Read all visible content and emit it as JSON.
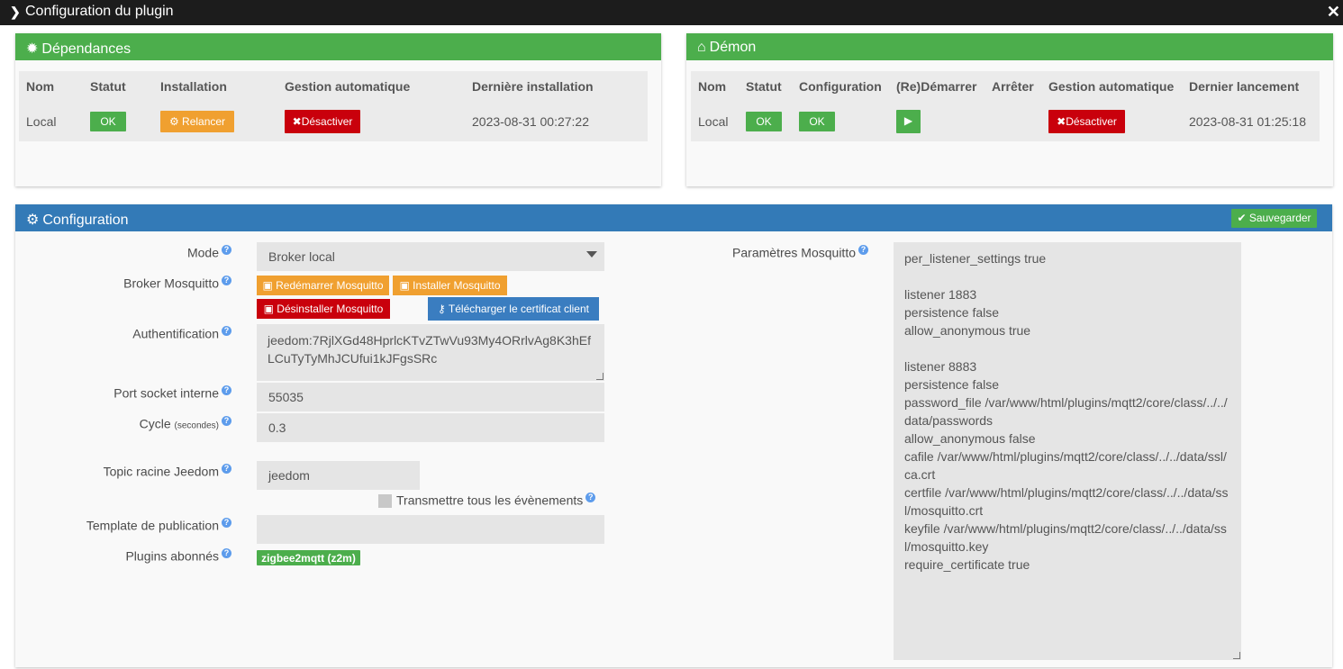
{
  "window": {
    "title": "Configuration du plugin",
    "close_glyph": "✕"
  },
  "dependances": {
    "title": "Dépendances",
    "headers": {
      "nom": "Nom",
      "statut": "Statut",
      "installation": "Installation",
      "gestion": "Gestion automatique",
      "derniere": "Dernière installation"
    },
    "row": {
      "nom": "Local",
      "statut": "OK",
      "installation": "Relancer",
      "gestion": "Désactiver",
      "derniere": "2023-08-31 00:27:22"
    }
  },
  "demon": {
    "title": "Démon",
    "headers": {
      "nom": "Nom",
      "statut": "Statut",
      "configuration": "Configuration",
      "redemarrer": "(Re)Démarrer",
      "arreter": "Arrêter",
      "gestion": "Gestion automatique",
      "dernier": "Dernier lancement"
    },
    "row": {
      "nom": "Local",
      "statut": "OK",
      "configuration": "OK",
      "gestion": "Désactiver",
      "dernier": "2023-08-31 01:25:18"
    }
  },
  "configuration": {
    "title": "Configuration",
    "save_label": "Sauvegarder",
    "mode": {
      "label": "Mode",
      "value": "Broker local"
    },
    "broker": {
      "label": "Broker Mosquitto",
      "restart": "Redémarrer Mosquitto",
      "install": "Installer Mosquitto",
      "uninstall": "Désinstaller Mosquitto",
      "download_cert": "Télécharger le certificat client"
    },
    "auth": {
      "label": "Authentification",
      "value": "jeedom:7RjlXGd48HprlcKTvZTwVu93My4ORrlvAg8K3hEfLCuTyTyMhJCUfui1kJFgsSRc"
    },
    "port": {
      "label": "Port socket interne",
      "value": "55035"
    },
    "cycle": {
      "label": "Cycle",
      "unit": "(secondes)",
      "value": "0.3"
    },
    "topic": {
      "label": "Topic racine Jeedom",
      "value": "jeedom"
    },
    "transmit": {
      "label": "Transmettre tous les évènements",
      "checked": false
    },
    "template": {
      "label": "Template de publication",
      "value": ""
    },
    "plugins": {
      "label": "Plugins abonnés",
      "tag": "zigbee2mqtt (z2m)"
    },
    "mosquitto_params": {
      "label": "Paramètres Mosquitto",
      "value": "per_listener_settings true\n\nlistener 1883\npersistence false\nallow_anonymous true\n\nlistener 8883\npersistence false\npassword_file /var/www/html/plugins/mqtt2/core/class/../../data/passwords\nallow_anonymous false\ncafile /var/www/html/plugins/mqtt2/core/class/../../data/ssl/ca.crt\ncertfile /var/www/html/plugins/mqtt2/core/class/../../data/ssl/mosquitto.crt\nkeyfile /var/www/html/plugins/mqtt2/core/class/../../data/ssl/mosquitto.key\nrequire_certificate true"
    }
  },
  "colors": {
    "green": "#4cae4c",
    "blue": "#337ab7",
    "orange": "#f0a030",
    "red": "#c9000c",
    "titlebar": "#1c1c1c"
  }
}
